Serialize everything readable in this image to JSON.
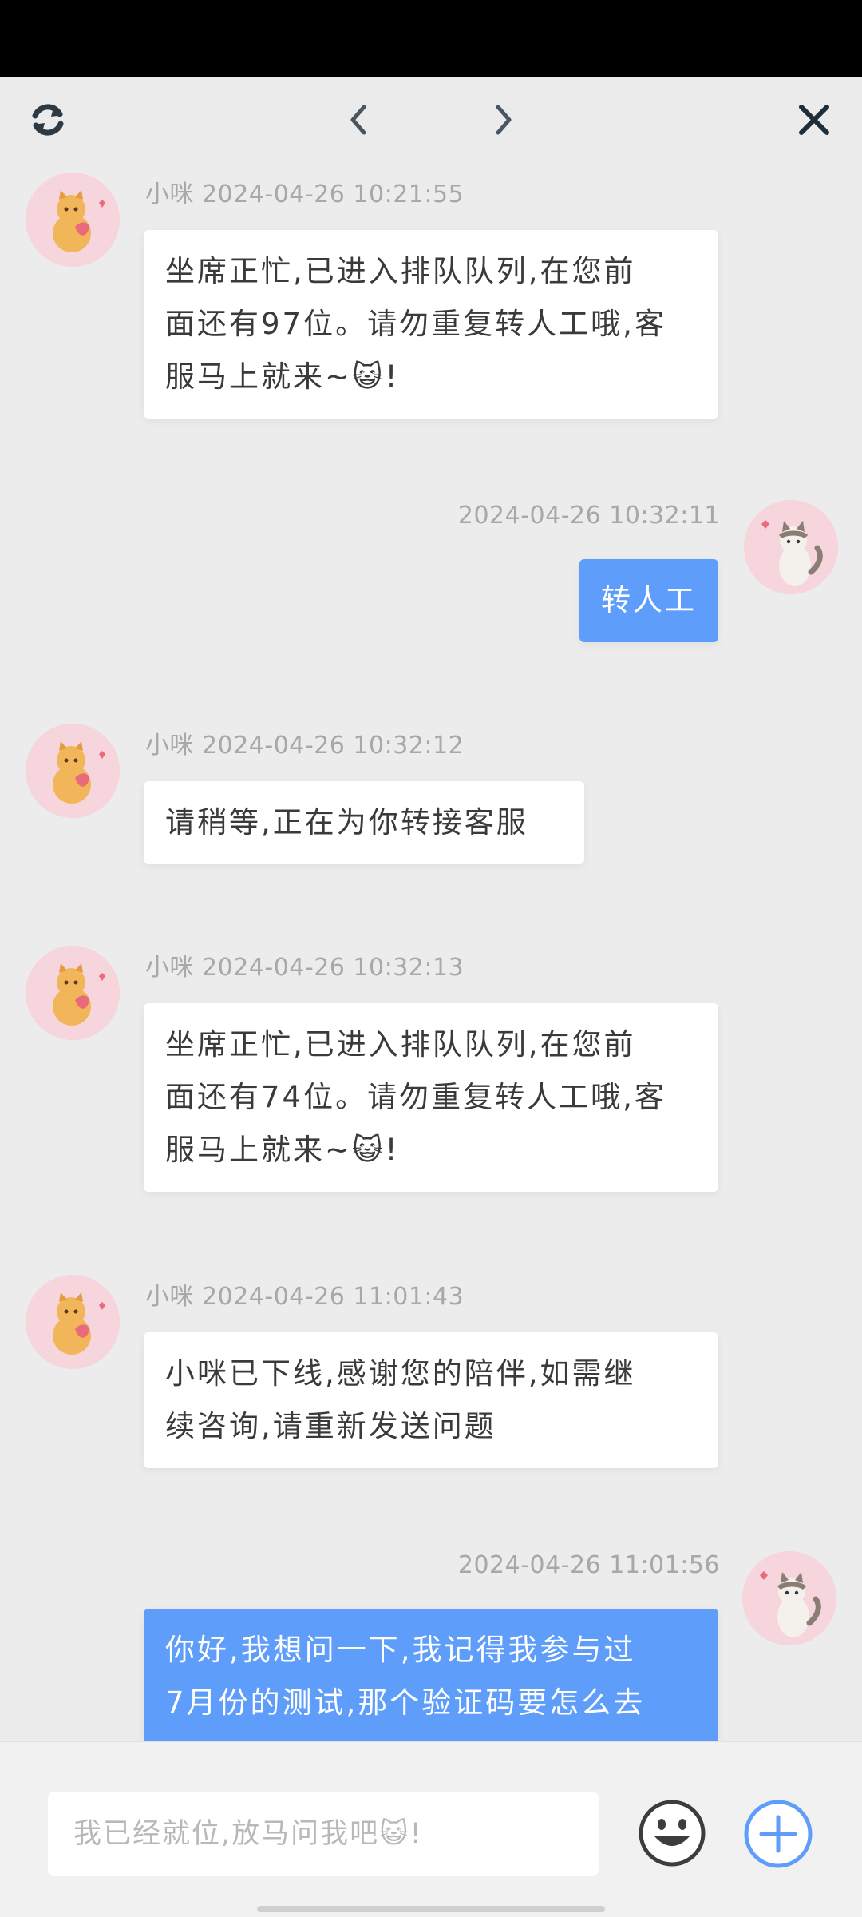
{
  "toolbar": {
    "refresh_icon": "refresh-icon",
    "prev_icon": "chevron-left-icon",
    "next_icon": "chevron-right-icon",
    "close_icon": "close-icon"
  },
  "messages": [
    {
      "side": "in",
      "sender": "小咪",
      "time": "2024-04-26 10:21:55",
      "meta": "小咪 2024-04-26 10:21:55",
      "lines": [
        "坐席正忙,已进入排队队列,在您前",
        "面还有97位。请勿重复转人工哦,客",
        "服马上就来~😺!"
      ]
    },
    {
      "side": "out",
      "time": "2024-04-26 10:32:11",
      "meta": "2024-04-26 10:32:11",
      "lines": [
        "转人工"
      ]
    },
    {
      "side": "in",
      "sender": "小咪",
      "time": "2024-04-26 10:32:12",
      "meta": "小咪 2024-04-26 10:32:12",
      "lines": [
        "请稍等,正在为你转接客服"
      ]
    },
    {
      "side": "in",
      "sender": "小咪",
      "time": "2024-04-26 10:32:13",
      "meta": "小咪 2024-04-26 10:32:13",
      "lines": [
        "坐席正忙,已进入排队队列,在您前",
        "面还有74位。请勿重复转人工哦,客",
        "服马上就来~😺!"
      ]
    },
    {
      "side": "in",
      "sender": "小咪",
      "time": "2024-04-26 11:01:43",
      "meta": "小咪 2024-04-26 11:01:43",
      "lines": [
        "小咪已下线,感谢您的陪伴,如需继",
        "续咨询,请重新发送问题"
      ]
    },
    {
      "side": "out",
      "time": "2024-04-26 11:01:56",
      "meta": "2024-04-26 11:01:56",
      "lines": [
        "你好,我想问一下,我记得我参与过",
        "7月份的测试,那个验证码要怎么去"
      ]
    }
  ],
  "composer": {
    "placeholder": "我已经就位,放马问我吧😺!",
    "emoji_icon": "emoji-icon",
    "plus_icon": "plus-circle-icon"
  },
  "colors": {
    "outgoing_bubble": "#5f9dfb",
    "incoming_bubble": "#ffffff",
    "background": "#ececec",
    "accent": "#5f9dfb"
  }
}
